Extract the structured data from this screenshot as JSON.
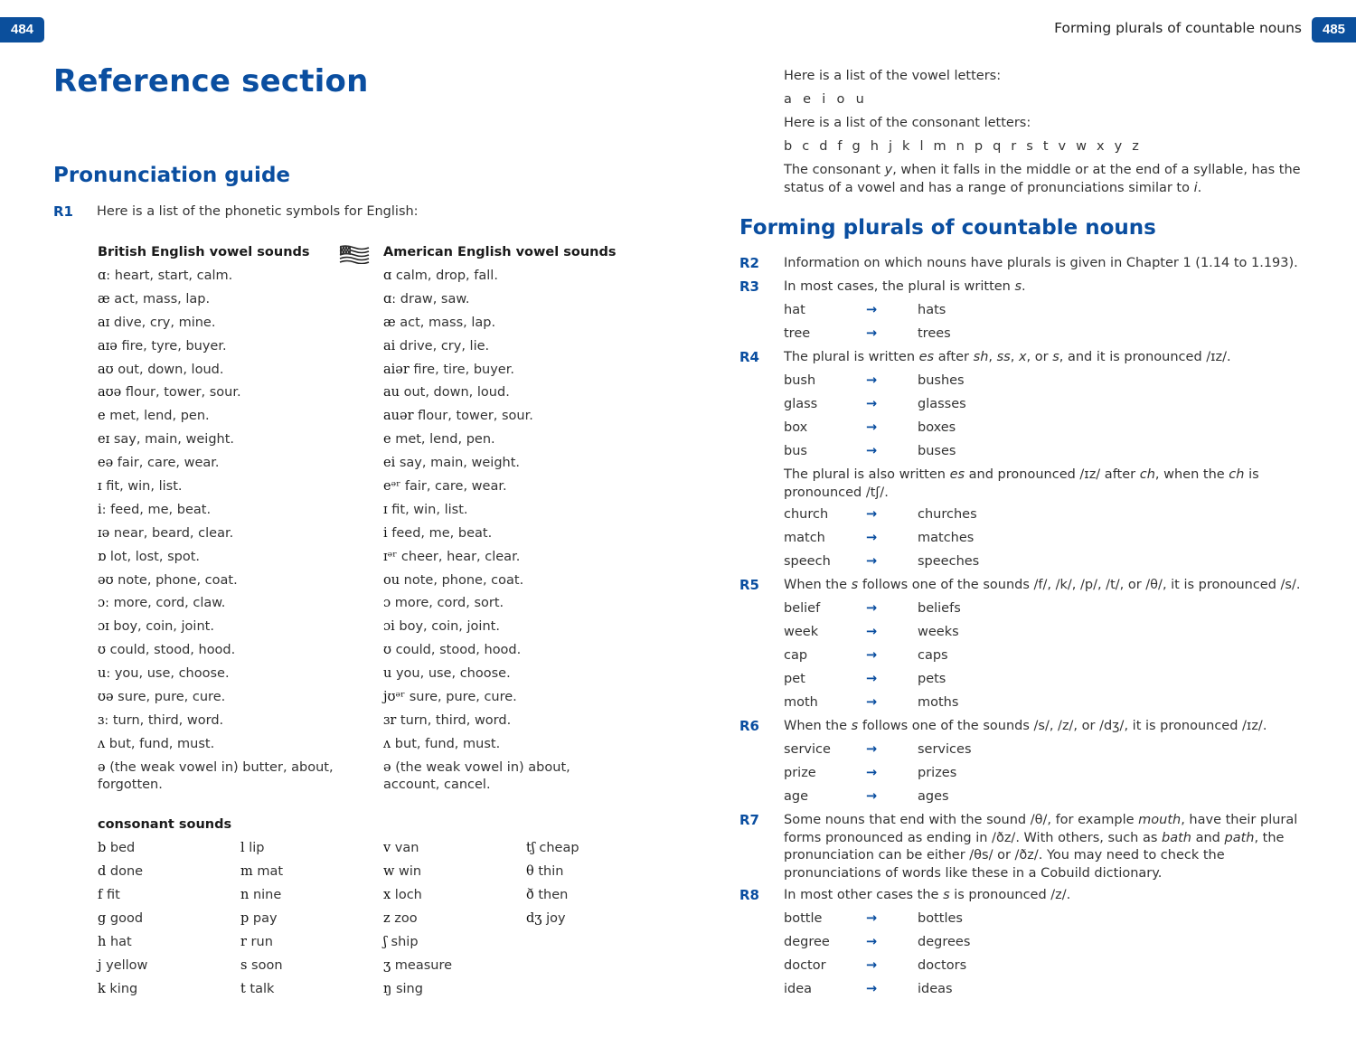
{
  "left_page": {
    "page_number": "484",
    "title": "Reference section",
    "section_heading": "Pronunciation guide",
    "r1": {
      "label": "R1",
      "text": "Here is a list of the phonetic symbols for English:"
    },
    "british_heading": "British English vowel sounds",
    "american_heading": "American English vowel sounds",
    "american_flag_icon": "us-flag-icon",
    "british_vowels": [
      {
        "sym": "ɑː",
        "ex": "heart, start, calm."
      },
      {
        "sym": "æ",
        "ex": "act, mass, lap."
      },
      {
        "sym": "aɪ",
        "ex": "dive, cry, mine."
      },
      {
        "sym": "aɪə",
        "ex": "fire, tyre, buyer."
      },
      {
        "sym": "aʊ",
        "ex": "out, down, loud."
      },
      {
        "sym": "aʊə",
        "ex": "flour, tower, sour."
      },
      {
        "sym": "e",
        "ex": "met, lend, pen."
      },
      {
        "sym": "eɪ",
        "ex": "say, main, weight."
      },
      {
        "sym": "eə",
        "ex": "fair, care, wear."
      },
      {
        "sym": "ɪ",
        "ex": "fit, win, list."
      },
      {
        "sym": "iː",
        "ex": "feed, me, beat."
      },
      {
        "sym": "ɪə",
        "ex": "near, beard, clear."
      },
      {
        "sym": "ɒ",
        "ex": "lot, lost, spot."
      },
      {
        "sym": "əʊ",
        "ex": "note, phone, coat."
      },
      {
        "sym": "ɔː",
        "ex": "more, cord, claw."
      },
      {
        "sym": "ɔɪ",
        "ex": "boy, coin, joint."
      },
      {
        "sym": "ʊ",
        "ex": "could, stood, hood."
      },
      {
        "sym": "uː",
        "ex": "you, use, choose."
      },
      {
        "sym": "ʊə",
        "ex": "sure, pure, cure."
      },
      {
        "sym": "ɜː",
        "ex": "turn, third, word."
      },
      {
        "sym": "ʌ",
        "ex": "but, fund, must."
      },
      {
        "sym": "ə",
        "ex": "(the weak vowel in) butter, about, forgotten."
      }
    ],
    "american_vowels": [
      {
        "sym": "ɑ",
        "ex": "calm, drop, fall."
      },
      {
        "sym": "ɑː",
        "ex": "draw, saw."
      },
      {
        "sym": "æ",
        "ex": "act, mass, lap."
      },
      {
        "sym": "ai",
        "ex": "drive, cry, lie."
      },
      {
        "sym": "aiər",
        "ex": "fire, tire, buyer."
      },
      {
        "sym": "au",
        "ex": "out, down, loud."
      },
      {
        "sym": "auər",
        "ex": "flour, tower, sour."
      },
      {
        "sym": "e",
        "ex": "met, lend, pen."
      },
      {
        "sym": "ei",
        "ex": "say, main, weight."
      },
      {
        "sym": "eᵊʳ",
        "ex": "fair, care, wear."
      },
      {
        "sym": "ɪ",
        "ex": "fit, win, list."
      },
      {
        "sym": "i",
        "ex": "feed, me, beat."
      },
      {
        "sym": "ɪᵊʳ",
        "ex": "cheer, hear, clear."
      },
      {
        "sym": "ou",
        "ex": "note, phone, coat."
      },
      {
        "sym": "ɔ",
        "ex": "more, cord, sort."
      },
      {
        "sym": "ɔi",
        "ex": "boy, coin, joint."
      },
      {
        "sym": "ʊ",
        "ex": "could, stood, hood."
      },
      {
        "sym": "u",
        "ex": "you, use, choose."
      },
      {
        "sym": "jʊᵊʳ",
        "ex": "sure, pure, cure."
      },
      {
        "sym": "ɜr",
        "ex": "turn, third, word."
      },
      {
        "sym": "ʌ",
        "ex": "but, fund, must."
      },
      {
        "sym": "ə",
        "ex": "(the weak vowel in) about, account, cancel."
      }
    ],
    "consonant_heading": "consonant sounds",
    "consonants": [
      {
        "sym": "b",
        "ex": "bed"
      },
      {
        "sym": "l",
        "ex": "lip"
      },
      {
        "sym": "v",
        "ex": "van"
      },
      {
        "sym": "tʃ",
        "ex": "cheap"
      },
      {
        "sym": "d",
        "ex": "done"
      },
      {
        "sym": "m",
        "ex": "mat"
      },
      {
        "sym": "w",
        "ex": "win"
      },
      {
        "sym": "θ",
        "ex": "thin"
      },
      {
        "sym": "f",
        "ex": "fit"
      },
      {
        "sym": "n",
        "ex": "nine"
      },
      {
        "sym": "x",
        "ex": "loch"
      },
      {
        "sym": "ð",
        "ex": "then"
      },
      {
        "sym": "g",
        "ex": "good"
      },
      {
        "sym": "p",
        "ex": "pay"
      },
      {
        "sym": "z",
        "ex": "zoo"
      },
      {
        "sym": "dʒ",
        "ex": "joy"
      },
      {
        "sym": "h",
        "ex": "hat"
      },
      {
        "sym": "r",
        "ex": "run"
      },
      {
        "sym": "ʃ",
        "ex": "ship"
      },
      {
        "sym": "",
        "ex": ""
      },
      {
        "sym": "j",
        "ex": "yellow"
      },
      {
        "sym": "s",
        "ex": "soon"
      },
      {
        "sym": "ʒ",
        "ex": "measure"
      },
      {
        "sym": "",
        "ex": ""
      },
      {
        "sym": "k",
        "ex": "king"
      },
      {
        "sym": "t",
        "ex": "talk"
      },
      {
        "sym": "ŋ",
        "ex": "sing"
      },
      {
        "sym": "",
        "ex": ""
      }
    ]
  },
  "right_page": {
    "page_number": "485",
    "running_head": "Forming plurals of countable nouns",
    "vowel_letters_intro": "Here is a list of the vowel letters:",
    "vowel_letters": "a  e  i  o  u",
    "consonant_letters_intro": "Here is a list of the consonant letters:",
    "consonant_letters": "b  c  d  f  g  h  j  k  l  m  n  p  q  r  s  t  v  w  x  y  z",
    "y_note": "The consonant y, when it falls in the middle or at the end of a syllable, has the status of a vowel and has a range of pronunciations similar to i.",
    "section_heading": "Forming plurals of countable nouns",
    "arrow_icon": "→",
    "rules": {
      "r2": {
        "label": "R2",
        "text": "Information on which nouns have plurals is given in Chapter 1 (1.14 to 1.193)."
      },
      "r3": {
        "label": "R3",
        "text": "In most cases, the plural is written s.",
        "examples": [
          [
            "hat",
            "hats"
          ],
          [
            "tree",
            "trees"
          ]
        ]
      },
      "r4": {
        "label": "R4",
        "text": "The plural is written es after sh, ss, x, or s, and it is pronounced /ɪz/.",
        "examples": [
          [
            "bush",
            "bushes"
          ],
          [
            "glass",
            "glasses"
          ],
          [
            "box",
            "boxes"
          ],
          [
            "bus",
            "buses"
          ]
        ],
        "note": "The plural is also written es and pronounced /ɪz/ after ch, when the ch is pronounced /tʃ/.",
        "examples2": [
          [
            "church",
            "churches"
          ],
          [
            "match",
            "matches"
          ],
          [
            "speech",
            "speeches"
          ]
        ]
      },
      "r5": {
        "label": "R5",
        "text": "When the s follows one of the sounds /f/, /k/, /p/, /t/, or /θ/, it is pronounced /s/.",
        "examples": [
          [
            "belief",
            "beliefs"
          ],
          [
            "week",
            "weeks"
          ],
          [
            "cap",
            "caps"
          ],
          [
            "pet",
            "pets"
          ],
          [
            "moth",
            "moths"
          ]
        ]
      },
      "r6": {
        "label": "R6",
        "text": "When the s follows one of the sounds /s/, /z/, or /dʒ/, it is pronounced /ɪz/.",
        "examples": [
          [
            "service",
            "services"
          ],
          [
            "prize",
            "prizes"
          ],
          [
            "age",
            "ages"
          ]
        ]
      },
      "r7": {
        "label": "R7",
        "text": "Some nouns that end with the sound /θ/, for example mouth, have their plural forms pronounced as ending in /ðz/. With others, such as bath and path, the pronunciation can be either /θs/ or /ðz/. You may need to check the pronunciations of words like these in a Cobuild dictionary."
      },
      "r8": {
        "label": "R8",
        "text": "In most other cases the s is pronounced /z/.",
        "examples": [
          [
            "bottle",
            "bottles"
          ],
          [
            "degree",
            "degrees"
          ],
          [
            "doctor",
            "doctors"
          ],
          [
            "idea",
            "ideas"
          ]
        ]
      }
    }
  }
}
